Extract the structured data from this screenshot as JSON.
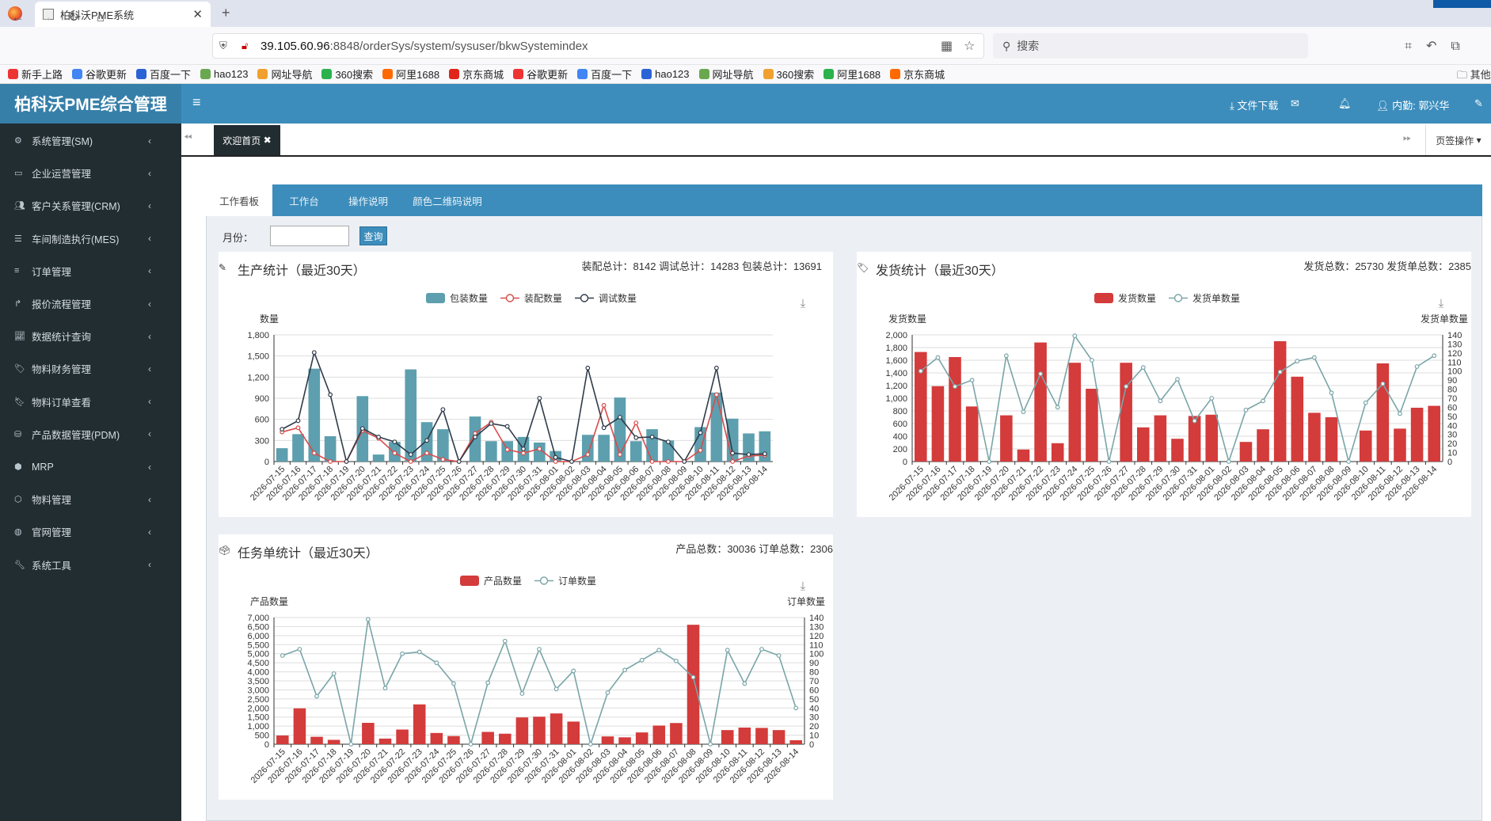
{
  "browser": {
    "tab_title": "柏科沃PME系统",
    "url_host": "39.105.60.96",
    "url_rest": ":8848/orderSys/system/sysuser/bkwSystemindex",
    "search_placeholder": "搜索",
    "bookmarks": [
      "新手上路",
      "谷歌更新",
      "百度一下",
      "hao123",
      "网址导航",
      "360搜索",
      "阿里1688",
      "京东商城",
      "谷歌更新",
      "百度一下",
      "hao123",
      "网址导航",
      "360搜索",
      "阿里1688",
      "京东商城"
    ],
    "bookmark_other": "其他"
  },
  "app": {
    "logo": "柏科沃PME综合管理",
    "header": {
      "file_download": "文件下载",
      "user": "内勤: 郭兴华"
    }
  },
  "sidebar": {
    "items": [
      {
        "label": "系统管理(SM)",
        "icon": "gear-icon"
      },
      {
        "label": "企业运营管理",
        "icon": "desktop-icon"
      },
      {
        "label": "客户关系管理(CRM)",
        "icon": "users-icon"
      },
      {
        "label": "车间制造执行(MES)",
        "icon": "list-icon"
      },
      {
        "label": "订单管理",
        "icon": "bars-icon"
      },
      {
        "label": "报价流程管理",
        "icon": "share-icon"
      },
      {
        "label": "数据统计查询",
        "icon": "line-chart-icon"
      },
      {
        "label": "物料财务管理",
        "icon": "tag-icon"
      },
      {
        "label": "物料订单查看",
        "icon": "bookmark-icon"
      },
      {
        "label": "产品数据管理(PDM)",
        "icon": "database-icon"
      },
      {
        "label": "MRP",
        "icon": "cube-icon"
      },
      {
        "label": "物料管理",
        "icon": "cubes-icon"
      },
      {
        "label": "官网管理",
        "icon": "globe-icon"
      },
      {
        "label": "系统工具",
        "icon": "wrench-icon"
      }
    ]
  },
  "tabs": {
    "welcome": "欢迎首页",
    "ops": "页签操作"
  },
  "inner_tabs": [
    "工作看板",
    "工作台",
    "操作说明",
    "颜色二维码说明"
  ],
  "filter": {
    "month_label": "月份：",
    "query": "查询"
  },
  "dates": [
    "2026-07-15",
    "2026-07-16",
    "2026-07-17",
    "2026-07-18",
    "2026-07-19",
    "2026-07-20",
    "2026-07-21",
    "2026-07-22",
    "2026-07-23",
    "2026-07-24",
    "2026-07-25",
    "2026-07-26",
    "2026-07-27",
    "2026-07-28",
    "2026-07-29",
    "2026-07-30",
    "2026-07-31",
    "2026-08-01",
    "2026-08-02",
    "2026-08-03",
    "2026-08-04",
    "2026-08-05",
    "2026-08-06",
    "2026-08-07",
    "2026-08-08",
    "2026-08-09",
    "2026-08-10",
    "2026-08-11",
    "2026-08-12",
    "2026-08-13",
    "2026-08-14"
  ],
  "production": {
    "title": "生产统计（最近30天）",
    "totals": "装配总计：8142 调试总计：14283 包装总计：13691",
    "legend": [
      "包装数量",
      "装配数量",
      "调试数量"
    ],
    "ylabel": "数量",
    "colors": {
      "bar": "#5d9fae",
      "assembly": "#d94b4b",
      "debug": "#2f3b4a"
    },
    "chart_data": {
      "type": "bar",
      "ylim": [
        0,
        1800
      ],
      "yticks": [
        "0",
        "300",
        "600",
        "900",
        "1,200",
        "1,500",
        "1,800"
      ],
      "series": [
        {
          "name": "包装数量",
          "type": "bar",
          "values": [
            190,
            390,
            1320,
            360,
            0,
            930,
            100,
            280,
            1310,
            560,
            460,
            0,
            640,
            290,
            290,
            350,
            270,
            150,
            0,
            380,
            380,
            910,
            290,
            460,
            300,
            0,
            490,
            980,
            610,
            400,
            430
          ]
        },
        {
          "name": "装配数量",
          "type": "line",
          "values": [
            420,
            480,
            120,
            0,
            0,
            440,
            330,
            120,
            0,
            120,
            30,
            0,
            400,
            560,
            170,
            120,
            180,
            0,
            0,
            100,
            800,
            100,
            550,
            0,
            0,
            0,
            160,
            950,
            0,
            80,
            90
          ]
        },
        {
          "name": "调试数量",
          "type": "line",
          "values": [
            460,
            580,
            1550,
            950,
            0,
            470,
            350,
            280,
            100,
            300,
            740,
            0,
            350,
            540,
            500,
            180,
            900,
            60,
            0,
            1330,
            480,
            630,
            340,
            350,
            280,
            0,
            410,
            1330,
            120,
            100,
            110
          ]
        }
      ]
    }
  },
  "shipping": {
    "title": "发货统计（最近30天）",
    "totals": "发货总数：25730 发货单总数：2385",
    "legend": [
      "发货数量",
      "发货单数量"
    ],
    "ylabel_left": "发货数量",
    "ylabel_right": "发货单数量",
    "colors": {
      "bar": "#d43b3b",
      "line": "#7aa5a8"
    },
    "chart_data": {
      "type": "bar",
      "ylim": [
        0,
        2000
      ],
      "y2lim": [
        0,
        140
      ],
      "yticks": [
        "0",
        "200",
        "400",
        "600",
        "800",
        "1,000",
        "1,200",
        "1,400",
        "1,600",
        "1,800",
        "2,000"
      ],
      "y2ticks": [
        "0",
        "10",
        "20",
        "30",
        "40",
        "50",
        "60",
        "70",
        "80",
        "90",
        "100",
        "110",
        "120",
        "130",
        "140"
      ],
      "series": [
        {
          "name": "发货数量",
          "type": "bar",
          "axis": "left",
          "values": [
            1730,
            1190,
            1650,
            870,
            0,
            730,
            190,
            1880,
            290,
            1560,
            1150,
            0,
            1560,
            540,
            730,
            360,
            720,
            740,
            0,
            310,
            510,
            1900,
            1340,
            770,
            700,
            0,
            490,
            1550,
            520,
            850,
            880
          ]
        },
        {
          "name": "发货单数量",
          "type": "line",
          "axis": "right",
          "values": [
            100,
            115,
            83,
            90,
            0,
            117,
            55,
            97,
            60,
            139,
            112,
            0,
            83,
            104,
            67,
            91,
            45,
            70,
            0,
            57,
            67,
            99,
            111,
            115,
            76,
            0,
            65,
            86,
            53,
            105,
            117
          ]
        }
      ]
    }
  },
  "tasks": {
    "title": "任务单统计（最近30天）",
    "totals": "产品总数：30036 订单总数：2306",
    "legend": [
      "产品数量",
      "订单数量"
    ],
    "ylabel_left": "产品数量",
    "ylabel_right": "订单数量",
    "colors": {
      "bar": "#d43b3b",
      "line": "#7aa5a8"
    },
    "chart_data": {
      "type": "bar",
      "ylim": [
        0,
        7000
      ],
      "y2lim": [
        0,
        140
      ],
      "yticks": [
        "0",
        "500",
        "1,000",
        "1,500",
        "2,000",
        "2,500",
        "3,000",
        "3,500",
        "4,000",
        "4,500",
        "5,000",
        "5,500",
        "6,000",
        "6,500",
        "7,000"
      ],
      "y2ticks": [
        "0",
        "10",
        "20",
        "30",
        "40",
        "50",
        "60",
        "70",
        "80",
        "90",
        "100",
        "110",
        "120",
        "130",
        "140"
      ],
      "series": [
        {
          "name": "产品数量",
          "type": "bar",
          "axis": "left",
          "values": [
            480,
            1980,
            410,
            240,
            0,
            1180,
            310,
            810,
            2200,
            620,
            450,
            0,
            680,
            580,
            1480,
            1520,
            1700,
            1250,
            0,
            430,
            380,
            650,
            1030,
            1170,
            6600,
            0,
            780,
            920,
            900,
            780,
            220
          ]
        },
        {
          "name": "订单数量",
          "type": "line",
          "axis": "right",
          "values": [
            98,
            105,
            53,
            78,
            0,
            138,
            62,
            100,
            102,
            90,
            67,
            0,
            68,
            114,
            56,
            105,
            61,
            81,
            0,
            57,
            82,
            93,
            104,
            92,
            74,
            0,
            104,
            67,
            105,
            98,
            40
          ]
        }
      ]
    }
  }
}
